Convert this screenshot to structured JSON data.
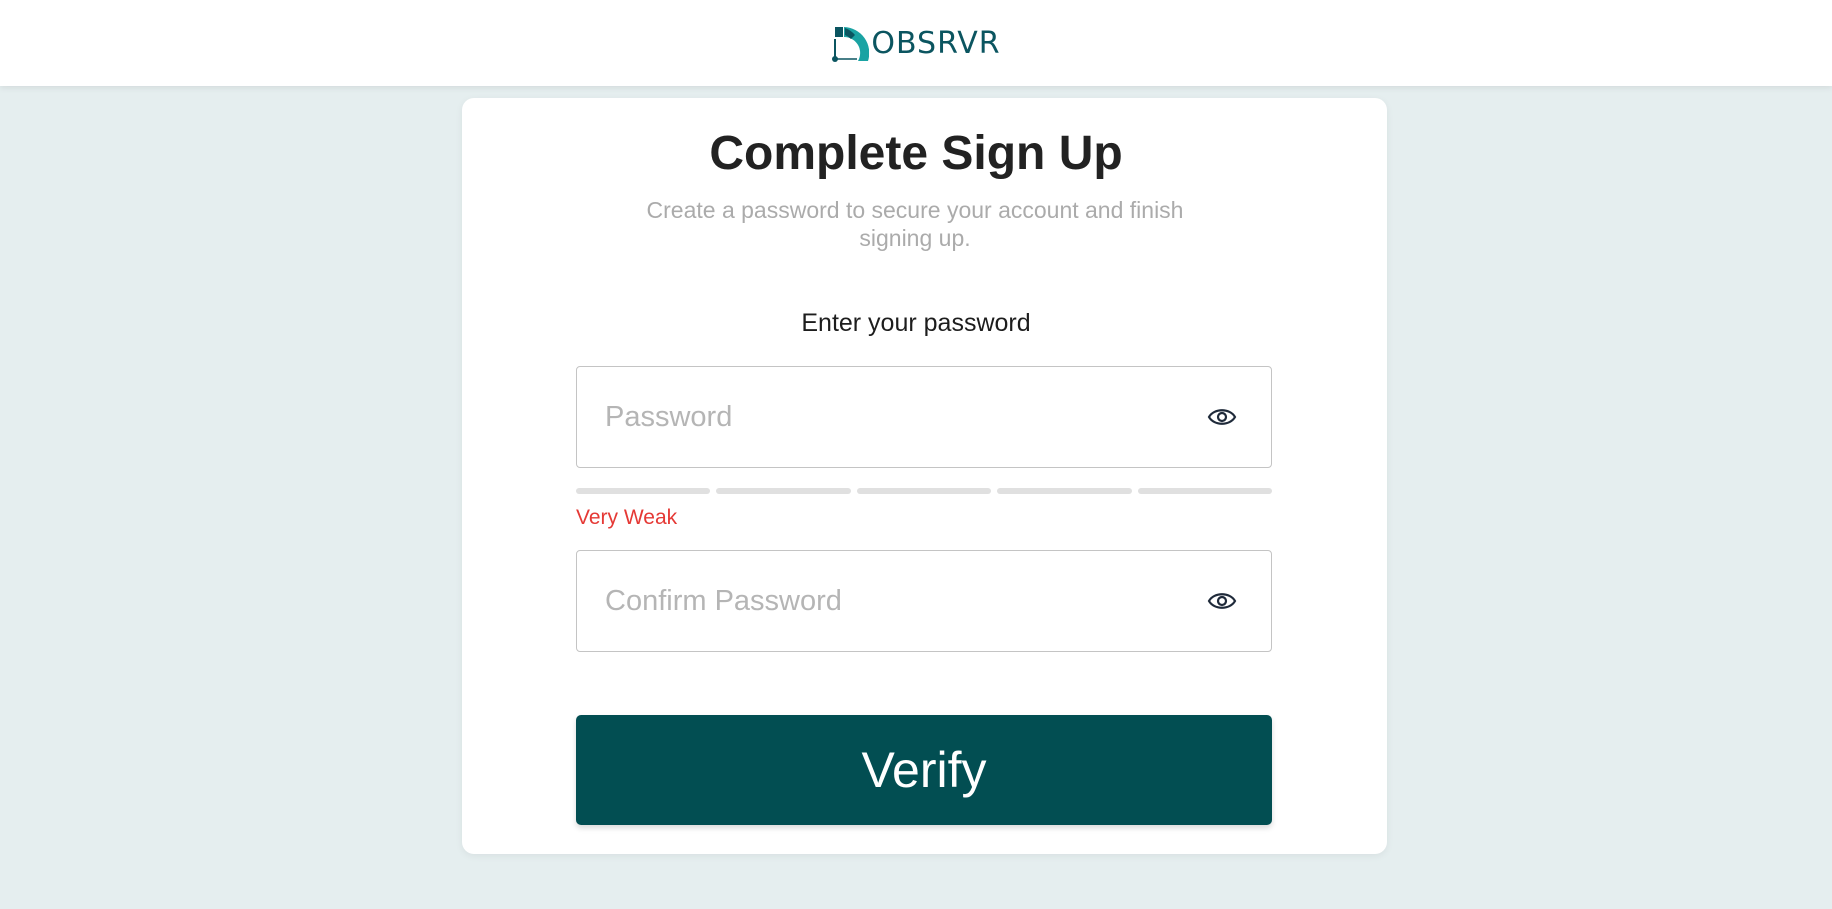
{
  "brand": {
    "name": "OBSRVR",
    "primary_color": "#024e52",
    "accent_color": "#1aa3a3"
  },
  "form": {
    "title": "Complete Sign Up",
    "subtitle": "Create a password to secure your account and finish signing up.",
    "field_label": "Enter your password",
    "password": {
      "value": "",
      "placeholder": "Password",
      "toggle_icon": "eye-icon"
    },
    "strength": {
      "segments_total": 5,
      "segments_filled": 0,
      "label": "Very Weak",
      "label_color": "#e53935"
    },
    "confirm_password": {
      "value": "",
      "placeholder": "Confirm Password",
      "toggle_icon": "eye-icon"
    },
    "submit_label": "Verify"
  }
}
